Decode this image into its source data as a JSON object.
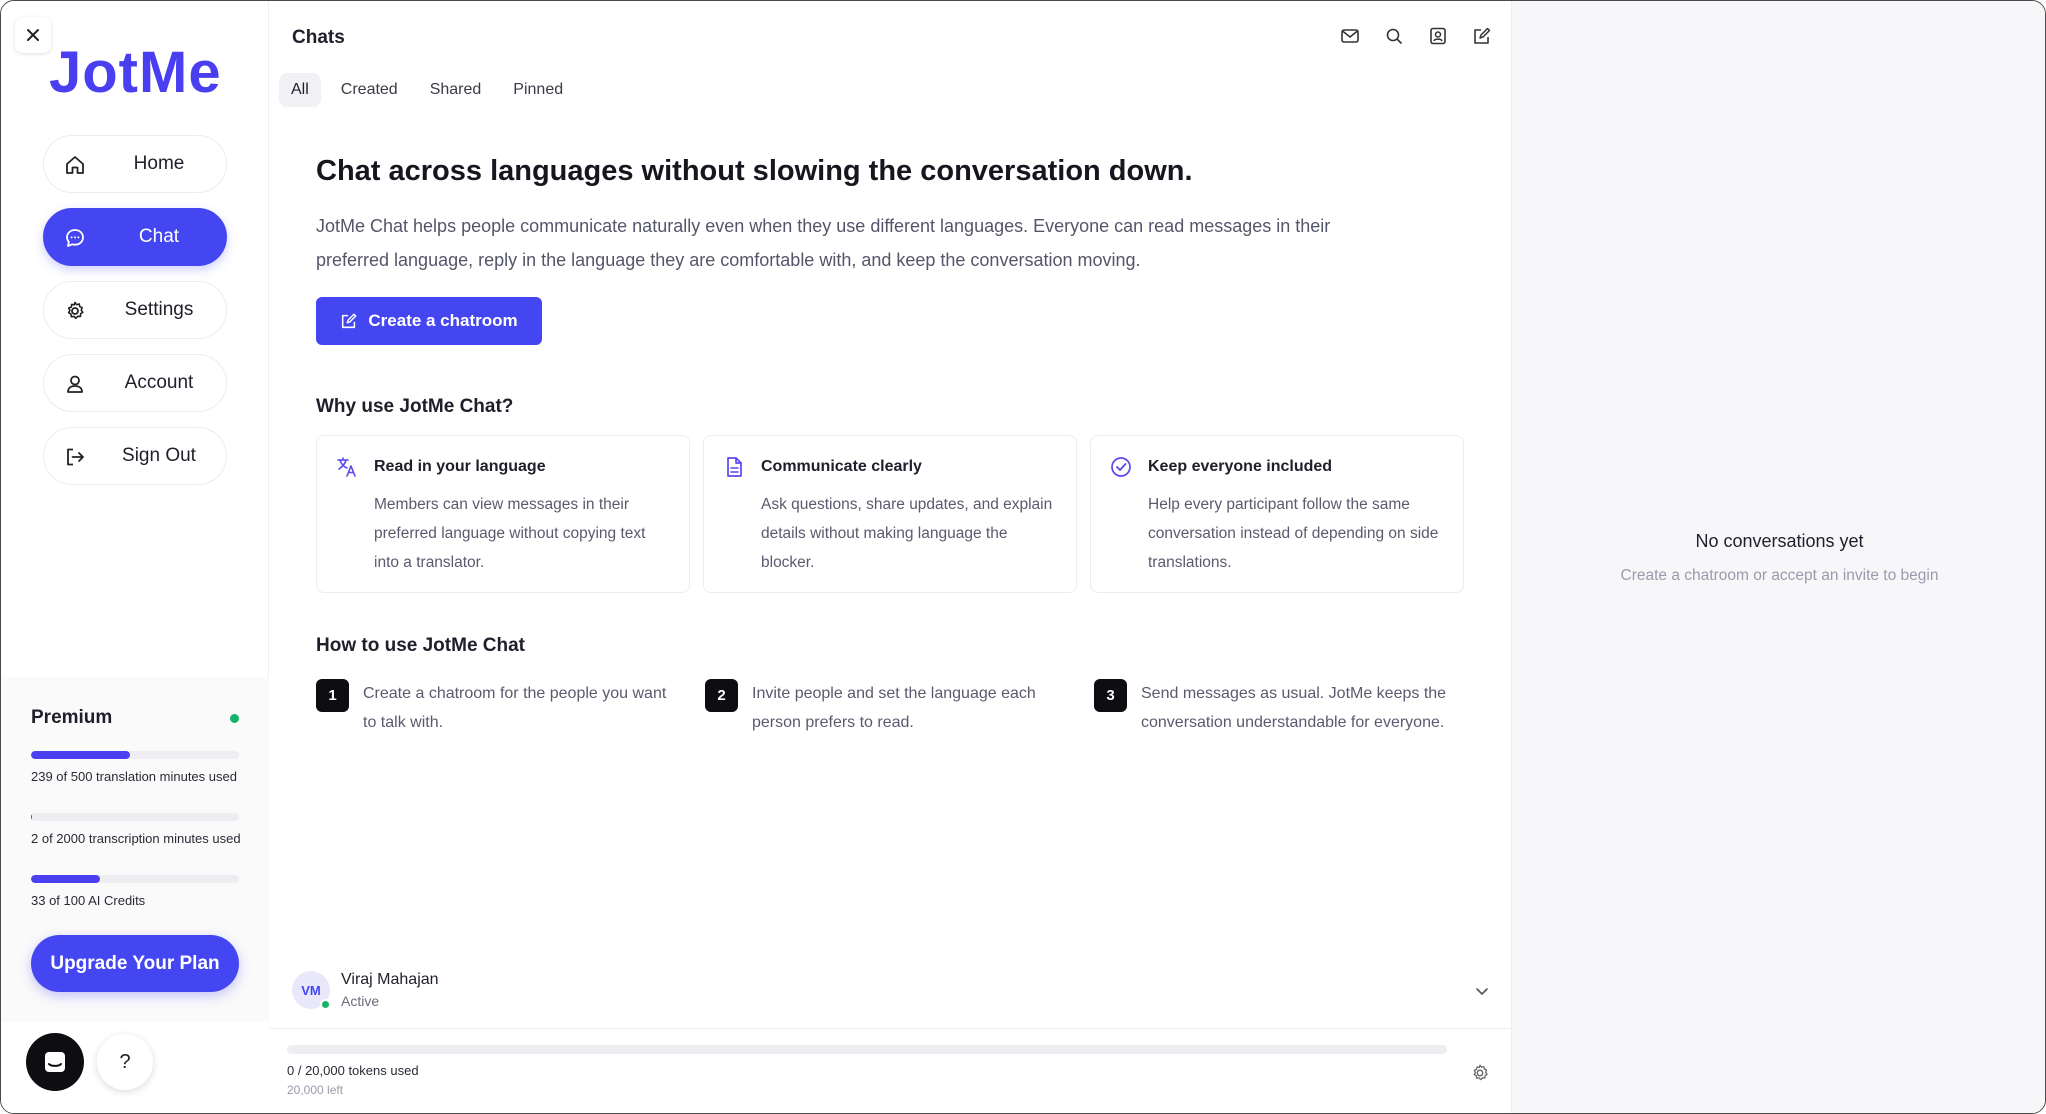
{
  "app": {
    "logo": "JotMe"
  },
  "sidebar": {
    "items": [
      {
        "label": "Home",
        "icon": "home-icon",
        "active": false
      },
      {
        "label": "Chat",
        "icon": "chat-bubble-icon",
        "active": true
      },
      {
        "label": "Settings",
        "icon": "gear-icon",
        "active": false
      },
      {
        "label": "Account",
        "icon": "user-icon",
        "active": false
      },
      {
        "label": "Sign Out",
        "icon": "sign-out-icon",
        "active": false
      }
    ],
    "plan": {
      "title": "Premium",
      "status_color": "#17b26a",
      "usage": [
        {
          "text": "239 of 500 translation minutes used",
          "fraction": 0.478
        },
        {
          "text": "2 of 2000 transcription minutes used",
          "fraction": 0.001
        },
        {
          "text": "33 of 100 AI Credits",
          "fraction": 0.33
        }
      ],
      "upgrade_label": "Upgrade Your Plan"
    },
    "help_label": "?"
  },
  "main": {
    "title": "Chats",
    "top_icons": [
      "mail-icon",
      "search-icon",
      "contact-icon",
      "compose-icon"
    ],
    "tabs": [
      "All",
      "Created",
      "Shared",
      "Pinned"
    ],
    "active_tab": "All",
    "hero": {
      "title": "Chat across languages without slowing the conversation down.",
      "description": "JotMe Chat helps people communicate naturally even when they use different languages. Everyone can read messages in their preferred language, reply in the language they are comfortable with, and keep the conversation moving.",
      "create_button": "Create a chatroom"
    },
    "why": {
      "title": "Why use JotMe Chat?",
      "cards": [
        {
          "title": "Read in your language",
          "text": "Members can view messages in their preferred language without copying text into a translator.",
          "icon": "translate-icon"
        },
        {
          "title": "Communicate clearly",
          "text": "Ask questions, share updates, and explain details without making language the blocker.",
          "icon": "document-icon"
        },
        {
          "title": "Keep everyone included",
          "text": "Help every participant follow the same conversation instead of depending on side translations.",
          "icon": "check-circle-icon"
        }
      ]
    },
    "how": {
      "title": "How to use JotMe Chat",
      "steps": [
        {
          "num": "1",
          "text": "Create a chatroom for the people you want to talk with."
        },
        {
          "num": "2",
          "text": "Invite people and set the language each person prefers to read."
        },
        {
          "num": "3",
          "text": "Send messages as usual. JotMe keeps the conversation understandable for everyone."
        }
      ]
    },
    "user": {
      "initials": "VM",
      "name": "Viraj Mahajan",
      "status": "Active"
    },
    "tokens": {
      "used_text": "0 / 20,000 tokens used",
      "left_text": "20,000 left",
      "fraction": 0
    }
  },
  "right_panel": {
    "empty_title": "No conversations yet",
    "empty_sub": "Create a chatroom or accept an invite to begin"
  },
  "colors": {
    "accent": "#4446f2",
    "logo": "#4a3ff0",
    "status_green": "#17b26a"
  }
}
